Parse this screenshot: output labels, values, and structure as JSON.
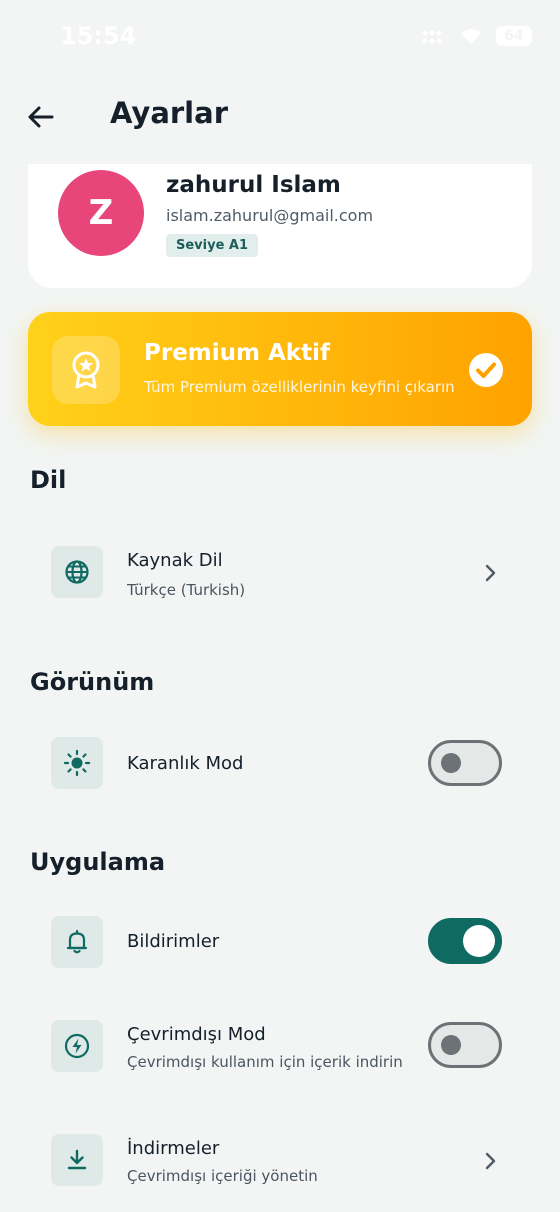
{
  "status_bar": {
    "time": "15:54",
    "battery": "64"
  },
  "header": {
    "title": "Ayarlar"
  },
  "profile": {
    "avatar_letter": "Z",
    "name": "zahurul Islam",
    "email": "islam.zahurul@gmail.com",
    "level": "Seviye A1"
  },
  "premium": {
    "title": "Premium Aktif",
    "subtitle": "Tüm Premium özelliklerinin keyfini çıkarın",
    "active": true
  },
  "sections": {
    "language": {
      "title": "Dil",
      "source_language": {
        "title": "Kaynak Dil",
        "value": "Türkçe (Turkish)"
      }
    },
    "appearance": {
      "title": "Görünüm",
      "dark_mode": {
        "title": "Karanlık Mod",
        "enabled": false
      }
    },
    "app": {
      "title": "Uygulama",
      "notifications": {
        "title": "Bildirimler",
        "enabled": true
      },
      "offline_mode": {
        "title": "Çevrimdışı Mod",
        "subtitle": "Çevrimdışı kullanım için içerik indirin",
        "enabled": false
      },
      "downloads": {
        "title": "İndirmeler",
        "subtitle": "Çevrimdışı içeriği yönetin"
      }
    }
  },
  "colors": {
    "accent": "#0f6b62",
    "avatar": "#e8457a",
    "premium_start": "#ffd11a",
    "premium_end": "#ffa200",
    "background": "#f2f5f4"
  },
  "icons": {
    "back": "arrow-left-icon",
    "premium": "award-ribbon-icon",
    "premium_check": "check-circle-icon",
    "source_language": "globe-icon",
    "dark_mode": "sun-icon",
    "notifications": "bell-icon",
    "offline_mode": "bolt-circle-icon",
    "downloads": "download-icon",
    "chevron": "chevron-right-icon"
  }
}
